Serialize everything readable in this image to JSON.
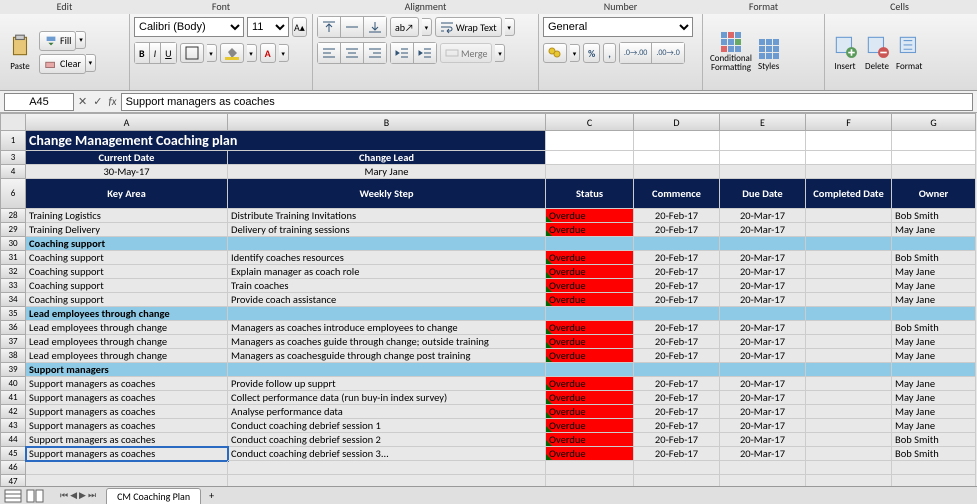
{
  "ribbon": {
    "groups": {
      "edit": "Edit",
      "font": "Font",
      "alignment": "Alignment",
      "number": "Number",
      "format": "Format",
      "cells": "Cells"
    },
    "paste": "Paste",
    "fill": "Fill",
    "clear": "Clear",
    "font_name": "Calibri (Body)",
    "font_size": "11",
    "wrap": "Wrap Text",
    "merge": "Merge",
    "number_format": "General",
    "cond_fmt": "Conditional\nFormatting",
    "styles": "Styles",
    "insert": "Insert",
    "delete": "Delete",
    "format": "Format"
  },
  "formula": {
    "cell_ref": "A45",
    "value": "Support managers as coaches"
  },
  "columns": [
    "A",
    "B",
    "C",
    "D",
    "E",
    "F",
    "G"
  ],
  "sheet": {
    "title": "Change Management Coaching plan",
    "h1a": "Current Date",
    "h1b": "Change Lead",
    "v1a": "30-May-17",
    "v1b": "Mary Jane",
    "headers": [
      "Key Area",
      "Weekly Step",
      "Status",
      "Commence",
      "Due Date",
      "Completed Date",
      "Owner"
    ]
  },
  "row_nums": [
    "1",
    "3",
    "4",
    "6",
    "28",
    "29",
    "30",
    "31",
    "32",
    "33",
    "34",
    "35",
    "36",
    "37",
    "38",
    "39",
    "40",
    "41",
    "42",
    "43",
    "44",
    "45",
    "46",
    "47"
  ],
  "rows": [
    {
      "n": "28",
      "a": "Training Logistics",
      "b": "Distribute Training Invitations",
      "c": "Overdue",
      "d": "20-Feb-17",
      "e": "20-Mar-17",
      "f": "",
      "g": "Bob Smith"
    },
    {
      "n": "29",
      "a": "Training Delivery",
      "b": "Delivery of training sessions",
      "c": "Overdue",
      "d": "20-Feb-17",
      "e": "20-Mar-17",
      "f": "",
      "g": "May Jane"
    },
    {
      "sec": "Coaching support",
      "n": "30"
    },
    {
      "n": "31",
      "a": "Coaching support",
      "b": "Identify coaches resources",
      "c": "Overdue",
      "d": "20-Feb-17",
      "e": "20-Mar-17",
      "f": "",
      "g": "Bob Smith"
    },
    {
      "n": "32",
      "a": "Coaching support",
      "b": "Explain manager as coach role",
      "c": "Overdue",
      "d": "20-Feb-17",
      "e": "20-Mar-17",
      "f": "",
      "g": "May Jane"
    },
    {
      "n": "33",
      "a": "Coaching support",
      "b": "Train coaches",
      "c": "Overdue",
      "d": "20-Feb-17",
      "e": "20-Mar-17",
      "f": "",
      "g": "May Jane"
    },
    {
      "n": "34",
      "a": "Coaching support",
      "b": "Provide coach assistance",
      "c": "Overdue",
      "d": "20-Feb-17",
      "e": "20-Mar-17",
      "f": "",
      "g": "May Jane"
    },
    {
      "sec": "Lead employees through change",
      "n": "35"
    },
    {
      "n": "36",
      "a": "Lead employees through change",
      "b": "Managers as coaches introduce employees to change",
      "c": "Overdue",
      "d": "20-Feb-17",
      "e": "20-Mar-17",
      "f": "",
      "g": "Bob Smith"
    },
    {
      "n": "37",
      "a": "Lead employees through change",
      "b": "Managers as coaches guide through change; outside training",
      "c": "Overdue",
      "d": "20-Feb-17",
      "e": "20-Mar-17",
      "f": "",
      "g": "May Jane"
    },
    {
      "n": "38",
      "a": "Lead employees through change",
      "b": "Managers as coachesguide through change post training",
      "c": "Overdue",
      "d": "20-Feb-17",
      "e": "20-Mar-17",
      "f": "",
      "g": "May Jane"
    },
    {
      "sec": "Support managers",
      "n": "39"
    },
    {
      "n": "40",
      "a": "Support managers as coaches",
      "b": "Provide follow up supprt",
      "c": "Overdue",
      "d": "20-Feb-17",
      "e": "20-Mar-17",
      "f": "",
      "g": "May Jane"
    },
    {
      "n": "41",
      "a": "Support managers as coaches",
      "b": "Collect performance data (run buy-in index survey)",
      "c": "Overdue",
      "d": "20-Feb-17",
      "e": "20-Mar-17",
      "f": "",
      "g": "May Jane"
    },
    {
      "n": "42",
      "a": "Support managers as coaches",
      "b": "Analyse performance data",
      "c": "Overdue",
      "d": "20-Feb-17",
      "e": "20-Mar-17",
      "f": "",
      "g": "May Jane"
    },
    {
      "n": "43",
      "a": "Support managers as coaches",
      "b": "Conduct coaching debrief session 1",
      "c": "Overdue",
      "d": "20-Feb-17",
      "e": "20-Mar-17",
      "f": "",
      "g": "May Jane"
    },
    {
      "n": "44",
      "a": "Support managers as coaches",
      "b": "Conduct coaching debrief session 2",
      "c": "Overdue",
      "d": "20-Feb-17",
      "e": "20-Mar-17",
      "f": "",
      "g": "Bob Smith"
    },
    {
      "n": "45",
      "a": "Support managers as coaches",
      "b": "Conduct coaching debrief session 3...",
      "c": "Overdue",
      "d": "20-Feb-17",
      "e": "20-Mar-17",
      "f": "",
      "g": "Bob Smith",
      "sel": true
    }
  ],
  "tab": "CM Coaching Plan"
}
